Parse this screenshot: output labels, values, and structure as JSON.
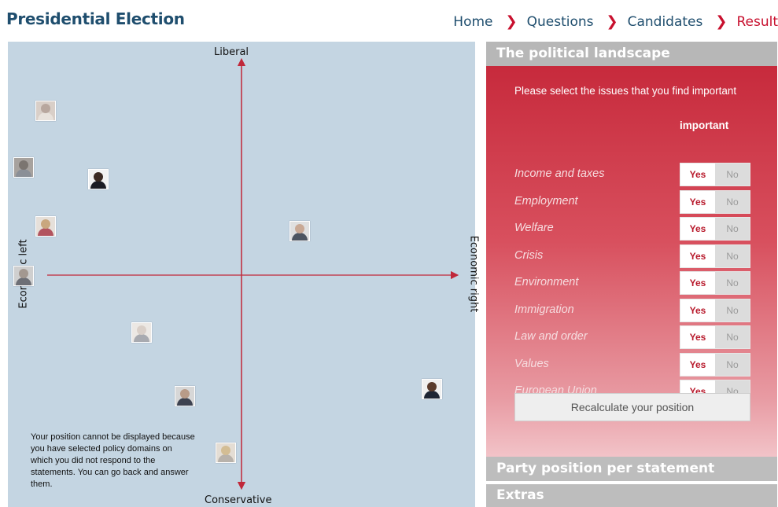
{
  "header": {
    "title": "Presidential Election",
    "breadcrumb": [
      {
        "label": "Home",
        "active": false
      },
      {
        "label": "Questions",
        "active": false
      },
      {
        "label": "Candidates",
        "active": false
      },
      {
        "label": "Result",
        "active": true
      }
    ],
    "separator_icon": "chevron-right-icon"
  },
  "plot": {
    "axis_top": "Liberal",
    "axis_bottom": "Conservative",
    "axis_left": "Economic left",
    "axis_right": "Economic right",
    "note": "Your position cannot be displayed because you have selected policy domains on which you did not respond to the statements. You can go back and answer them.",
    "candidates": [
      {
        "id": "candidate-1",
        "economic": -0.82,
        "social": 0.7,
        "photo": "grey-hair-woman"
      },
      {
        "id": "candidate-2",
        "economic": -0.91,
        "social": 0.46,
        "photo": "man-grey"
      },
      {
        "id": "candidate-3",
        "economic": -0.6,
        "social": 0.41,
        "photo": "man-dark-suit"
      },
      {
        "id": "candidate-4",
        "economic": -0.82,
        "social": 0.21,
        "photo": "woman-blonde"
      },
      {
        "id": "candidate-5",
        "economic": 0.24,
        "social": 0.19,
        "photo": "man-bald"
      },
      {
        "id": "candidate-6",
        "economic": -0.91,
        "social": 0.0,
        "photo": "man-grey-2"
      },
      {
        "id": "candidate-7",
        "economic": -0.42,
        "social": -0.24,
        "photo": "man-white-hair"
      },
      {
        "id": "candidate-8",
        "economic": -0.24,
        "social": -0.51,
        "photo": "man-suit"
      },
      {
        "id": "candidate-9",
        "economic": 0.79,
        "social": -0.48,
        "photo": "man-dark-hair"
      },
      {
        "id": "candidate-10",
        "economic": -0.07,
        "social": -0.75,
        "photo": "woman-blonde-2"
      }
    ]
  },
  "panel": {
    "section1_title": "The political landscape",
    "instruction": "Please select the issues that you find important",
    "column_header": "important",
    "yes_label": "Yes",
    "no_label": "No",
    "issues": [
      {
        "label": "Income and taxes",
        "selected": "Yes"
      },
      {
        "label": "Employment",
        "selected": "Yes"
      },
      {
        "label": "Welfare",
        "selected": "Yes"
      },
      {
        "label": "Crisis",
        "selected": "Yes"
      },
      {
        "label": "Environment",
        "selected": "Yes"
      },
      {
        "label": "Immigration",
        "selected": "Yes"
      },
      {
        "label": "Law and order",
        "selected": "Yes"
      },
      {
        "label": "Values",
        "selected": "Yes"
      },
      {
        "label": "European Union",
        "selected": "Yes"
      }
    ],
    "recalc_label": "Recalculate your position",
    "section2_title": "Party position per statement",
    "section3_title": "Extras"
  },
  "colors": {
    "accent": "#c8102e",
    "title": "#1f4e6e",
    "plot_bg": "#c4d5e2"
  }
}
